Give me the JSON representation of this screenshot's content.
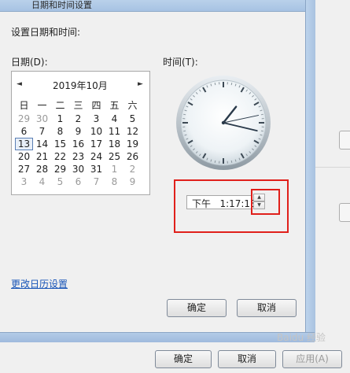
{
  "window": {
    "title": "日期和时间设置"
  },
  "prompt": "设置日期和时间:",
  "date_label": "日期(D):",
  "time_label": "时间(T):",
  "calendar": {
    "prev": "◄",
    "next": "►",
    "month_title": "2019年10月",
    "weekdays": [
      "日",
      "一",
      "二",
      "三",
      "四",
      "五",
      "六"
    ],
    "weeks": [
      [
        "29",
        "30",
        "1",
        "2",
        "3",
        "4",
        "5"
      ],
      [
        "6",
        "7",
        "8",
        "9",
        "10",
        "11",
        "12"
      ],
      [
        "13",
        "14",
        "15",
        "16",
        "17",
        "18",
        "19"
      ],
      [
        "20",
        "21",
        "22",
        "23",
        "24",
        "25",
        "26"
      ],
      [
        "27",
        "28",
        "29",
        "30",
        "31",
        "1",
        "2"
      ],
      [
        "3",
        "4",
        "5",
        "6",
        "7",
        "8",
        "9"
      ]
    ],
    "selected_day": "13"
  },
  "clock": {
    "hour": 1,
    "minute": 17,
    "second": 13
  },
  "time_value": "下午   1:17:13",
  "spin": {
    "up": "▲",
    "down": "▼"
  },
  "calendar_settings_link": "更改日历设置",
  "ok_button": "确定",
  "cancel_button": "取消",
  "outer": {
    "ok_button": "确定",
    "cancel_button": "取消",
    "apply_button": "应用(A)"
  },
  "watermark": "Baidu 经验",
  "colors": {
    "highlight_red": "#e0201b",
    "link_blue": "#1a56b8"
  }
}
